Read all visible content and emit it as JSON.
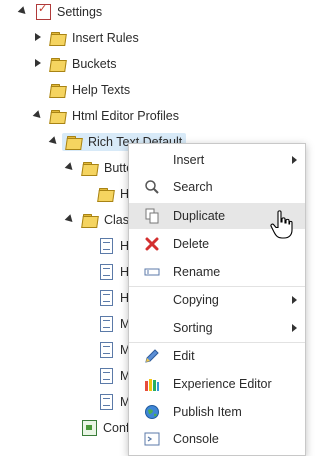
{
  "tree": {
    "settings": "Settings",
    "insert_rules": "Insert Rules",
    "buckets": "Buckets",
    "help_texts": "Help Texts",
    "html_editor_profiles": "Html Editor Profiles",
    "rich_text_default": "Rich Text Default",
    "buttons_partial": "Butto",
    "h_partial": "H",
    "classes_partial": "Class",
    "items": [
      "H",
      "H",
      "H",
      "M",
      "M",
      "M",
      "M"
    ],
    "conf_partial": "Conf"
  },
  "context_menu": {
    "items": [
      {
        "label": "Insert",
        "icon": "none",
        "submenu": true
      },
      {
        "label": "Search",
        "icon": "search-icon",
        "submenu": false
      },
      {
        "label": "Duplicate",
        "icon": "duplicate-icon",
        "submenu": false,
        "hover": true
      },
      {
        "label": "Delete",
        "icon": "delete-x-icon",
        "submenu": false
      },
      {
        "label": "Rename",
        "icon": "rename-icon",
        "submenu": false
      },
      {
        "label": "Copying",
        "icon": "none",
        "submenu": true
      },
      {
        "label": "Sorting",
        "icon": "none",
        "submenu": true
      },
      {
        "label": "Edit",
        "icon": "pencil-icon",
        "submenu": false
      },
      {
        "label": "Experience Editor",
        "icon": "experience-editor-icon",
        "submenu": false
      },
      {
        "label": "Publish Item",
        "icon": "globe-icon",
        "submenu": false
      },
      {
        "label": "Console",
        "icon": "console-icon",
        "submenu": false
      }
    ]
  },
  "colors": {
    "selection": "#d8eaf8",
    "hover": "#e6e6e6",
    "delete_red": "#d32f2f",
    "folder_yellow": "#f5d460"
  }
}
